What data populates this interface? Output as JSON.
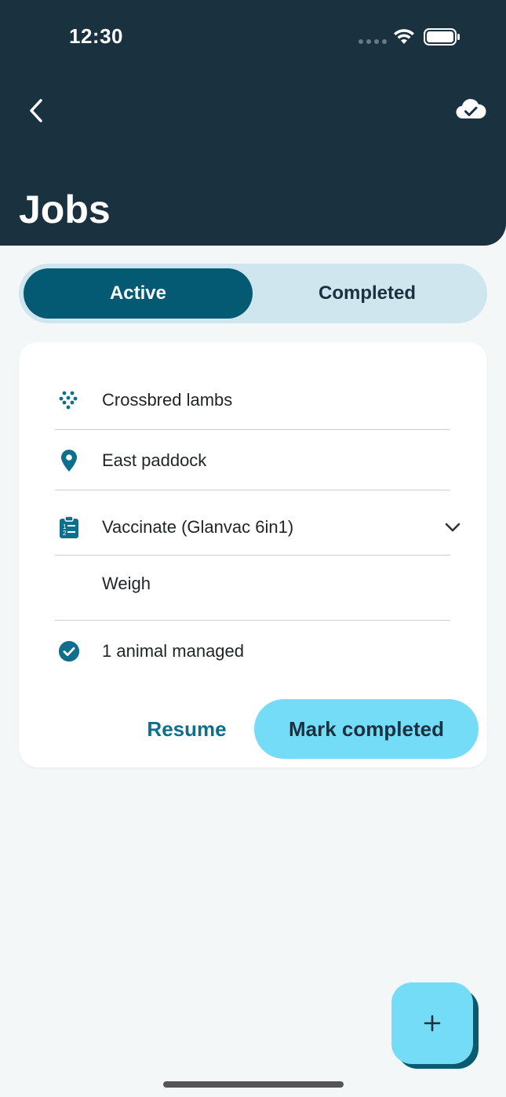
{
  "status_bar": {
    "time": "12:30"
  },
  "header": {
    "title": "Jobs",
    "back_icon": "chevron-left-icon",
    "sync_icon": "cloud-check-icon"
  },
  "tabs": [
    {
      "label": "Active",
      "selected": true
    },
    {
      "label": "Completed",
      "selected": false
    }
  ],
  "job_card": {
    "mob": "Crossbred lambs",
    "location": "East paddock",
    "tasks": [
      "Vaccinate (Glanvac 6in1)",
      "Weigh"
    ],
    "managed": "1 animal managed",
    "resume_label": "Resume",
    "mark_completed_label": "Mark completed"
  },
  "fab": {
    "icon": "plus-icon"
  },
  "colors": {
    "header_bg": "#1a3140",
    "accent": "#045a73",
    "primary_button": "#74dcf7",
    "icon_teal": "#0e6f8c"
  }
}
